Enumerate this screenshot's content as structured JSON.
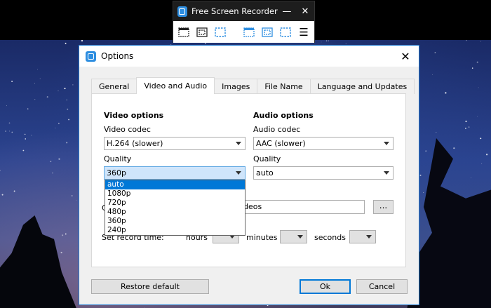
{
  "recorder": {
    "title": "Free Screen Recorder",
    "minimize": "—",
    "close": "✕",
    "menu": "☰",
    "tools": [
      "record-window-icon",
      "record-region-icon",
      "record-fullscreen-icon",
      "screenshot-window-icon",
      "screenshot-region-icon",
      "screenshot-fullscreen-icon",
      "menu-icon"
    ]
  },
  "dialog": {
    "title": "Options",
    "close": "✕",
    "tabs": [
      "General",
      "Video and Audio",
      "Images",
      "File Name",
      "Language and Updates"
    ],
    "active_tab": "Video and Audio",
    "video": {
      "heading": "Video options",
      "codec_label": "Video codec",
      "codec_value": "H.264 (slower)",
      "quality_label": "Quality",
      "quality_value": "360p",
      "quality_options": [
        "auto",
        "1080p",
        "720p",
        "480p",
        "360p",
        "240p"
      ],
      "highlighted_option": "auto"
    },
    "audio": {
      "heading": "Audio options",
      "codec_label": "Audio codec",
      "codec_value": "AAC (slower)",
      "quality_label": "Quality",
      "quality_value": "auto"
    },
    "folder": {
      "label_partial": "C",
      "value_partial": "deos",
      "browse_label": "..."
    },
    "record_time": {
      "label": "Set record time:",
      "hours": "hours",
      "minutes": "minutes",
      "seconds": "seconds"
    },
    "buttons": {
      "restore": "Restore default",
      "ok": "Ok",
      "cancel": "Cancel"
    }
  },
  "colors": {
    "accent": "#0078d7",
    "recorder_bg": "#1d1d1d",
    "logo": "#2e8ee0"
  }
}
